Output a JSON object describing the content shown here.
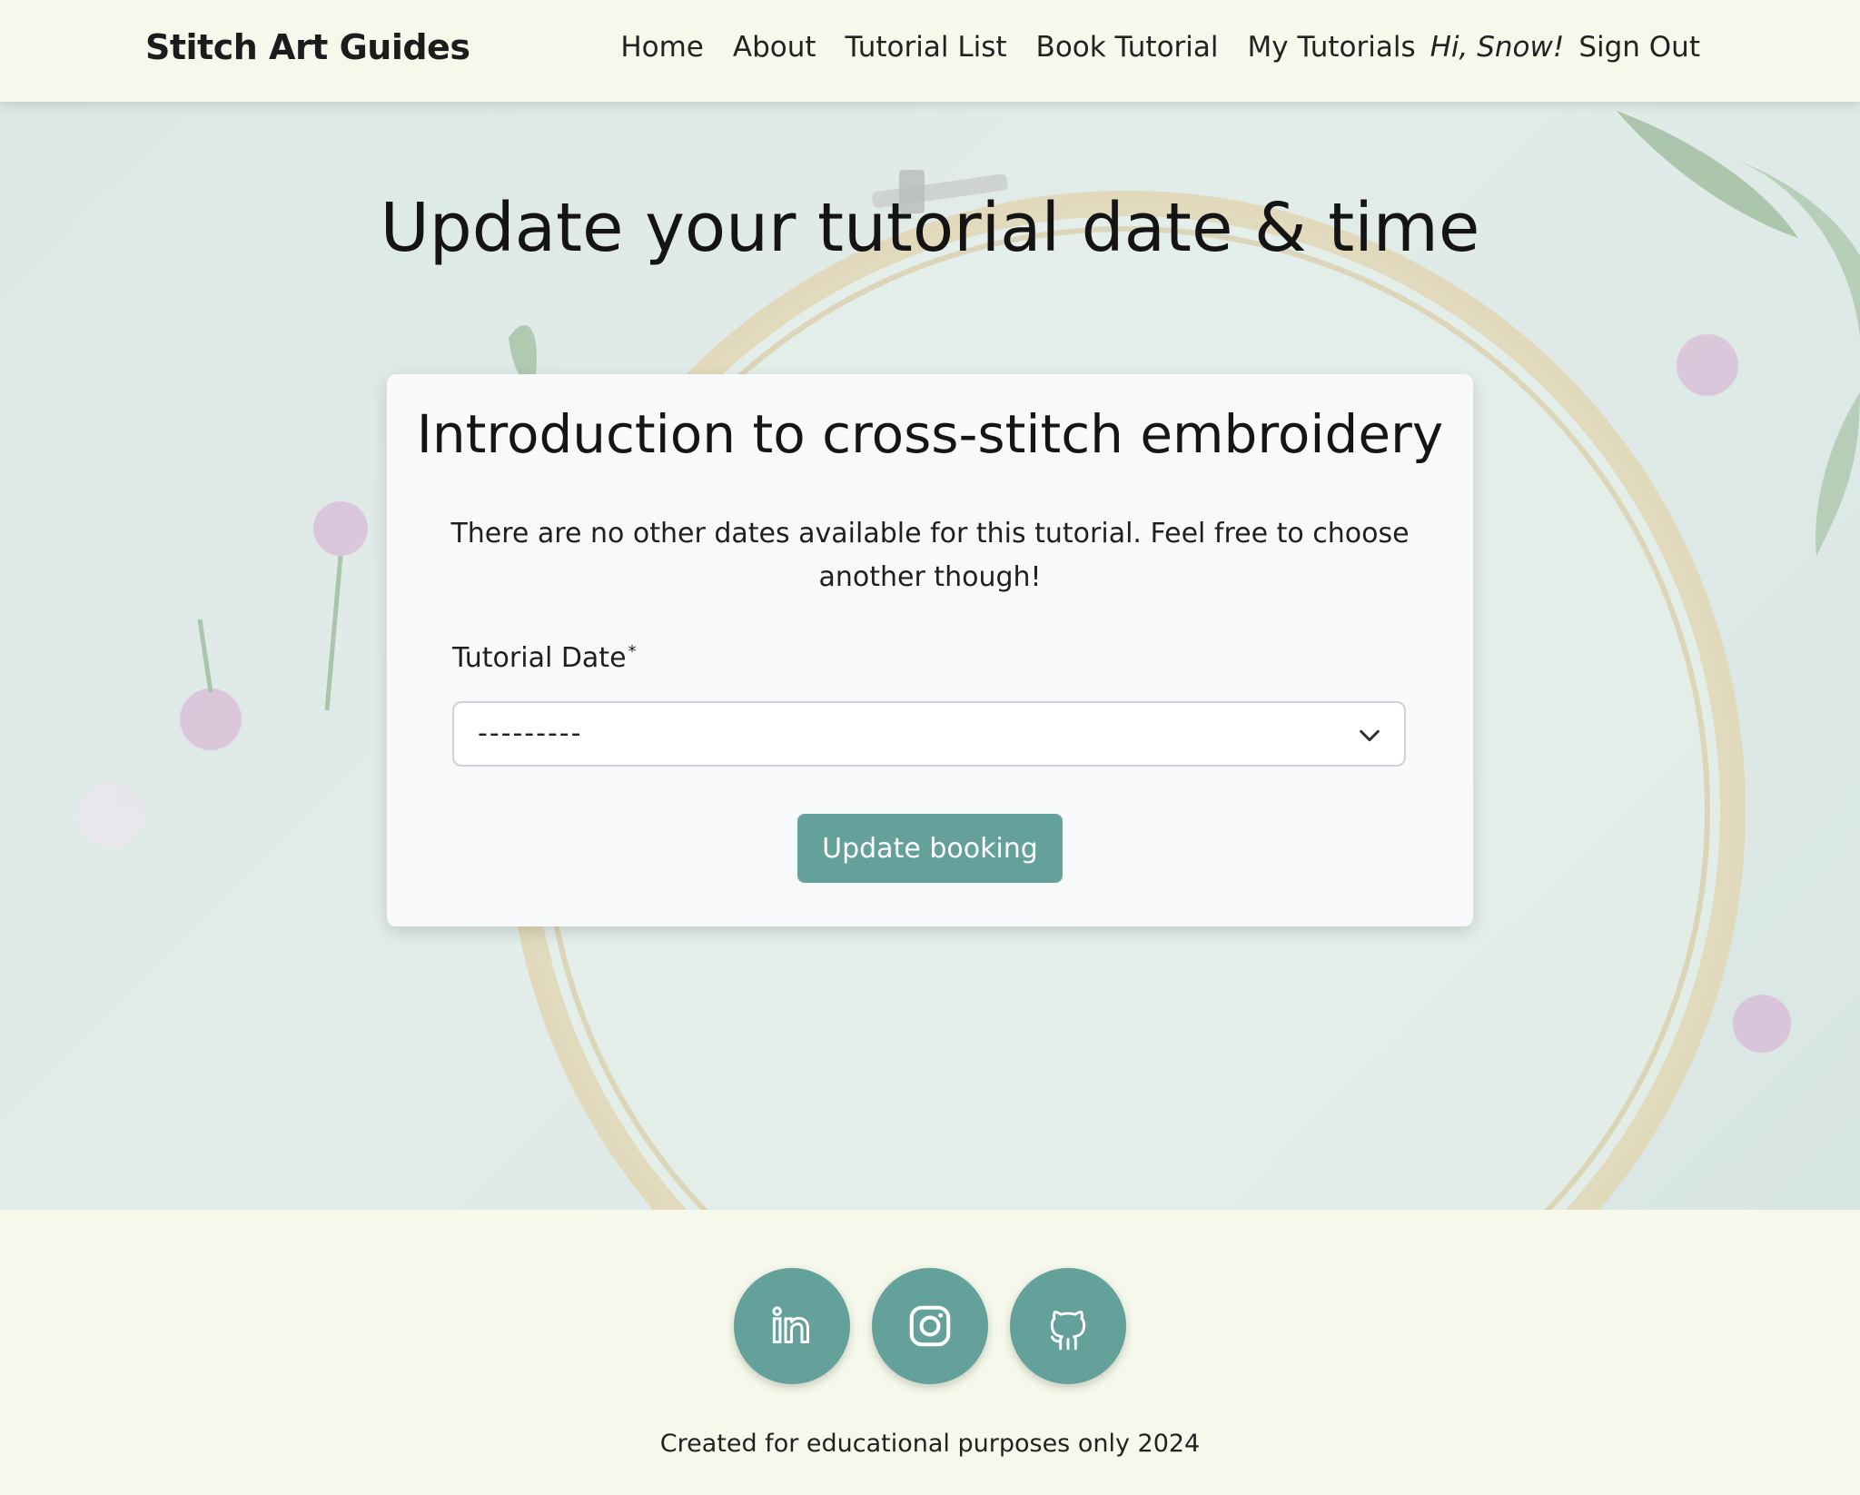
{
  "navbar": {
    "brand": "Stitch Art Guides",
    "links": [
      "Home",
      "About",
      "Tutorial List",
      "Book Tutorial",
      "My Tutorials"
    ],
    "greeting": "Hi, Snow!",
    "sign_out": "Sign Out"
  },
  "main": {
    "title": "Update your tutorial date & time",
    "card": {
      "heading": "Introduction to cross-stitch embroidery",
      "message": "There are no other dates available for this tutorial. Feel free to choose another though!",
      "date_label": "Tutorial Date",
      "required_marker": "*",
      "date_selected": "---------",
      "submit_label": "Update booking"
    }
  },
  "footer": {
    "social_icons": [
      "linkedin-icon",
      "instagram-icon",
      "github-icon"
    ],
    "copyright": "Created for educational purposes only 2024"
  },
  "colors": {
    "accent": "#63a19a",
    "nav_footer_bg": "#f5f8ea",
    "hero_bg": "#dde9e6"
  }
}
